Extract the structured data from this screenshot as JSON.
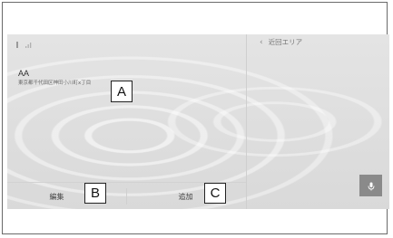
{
  "status": {
    "icons": [
      "signal-icon",
      "bars-icon"
    ]
  },
  "entry": {
    "name": "AA",
    "address": "東京都千代田区神田小川町x丁目"
  },
  "bottom_bar": {
    "edit_label": "編集",
    "add_label": "追加"
  },
  "right_panel": {
    "title": "近回エリア"
  },
  "callouts": {
    "a": "A",
    "b": "B",
    "c": "C"
  },
  "colors": {
    "mic_button_bg": "#8a8a8a",
    "screen_bg": "#dedede"
  }
}
